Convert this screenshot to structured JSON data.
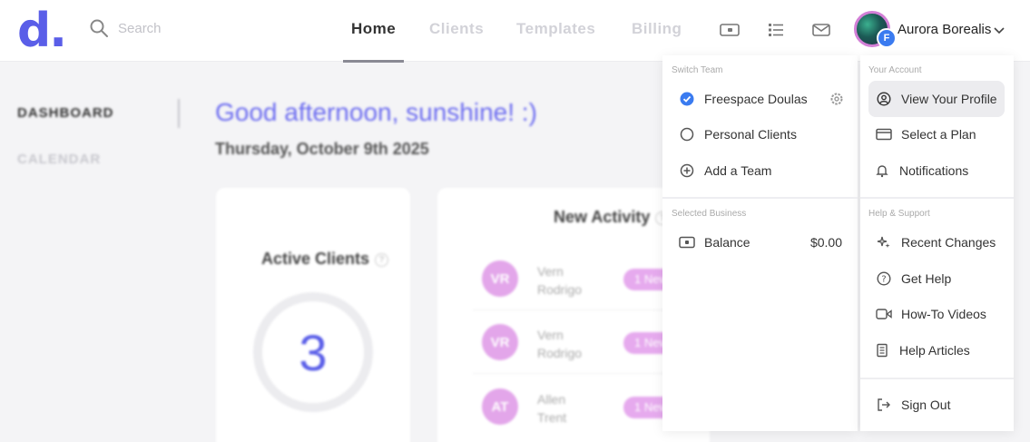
{
  "brand": {
    "logo_text": "d."
  },
  "search": {
    "placeholder": "Search"
  },
  "nav": {
    "home": "Home",
    "clients": "Clients",
    "templates": "Templates",
    "billing": "Billing"
  },
  "user": {
    "name": "Aurora Borealis",
    "badge_letter": "F"
  },
  "sidebar": {
    "dashboard": "DASHBOARD",
    "calendar": "CALENDAR"
  },
  "main": {
    "greeting": "Good afternoon, sunshine! :)",
    "date": "Thursday, October 9th 2025",
    "active_clients": {
      "title": "Active Clients",
      "count": "3"
    },
    "new_activity": {
      "title": "New Activity",
      "rows": [
        {
          "initials": "VR",
          "first": "Vern",
          "last": "Rodrigo",
          "pill": "1 New"
        },
        {
          "initials": "VR",
          "first": "Vern",
          "last": "Rodrigo",
          "pill": "1 New"
        },
        {
          "initials": "AT",
          "first": "Allen",
          "last": "Trent",
          "pill": "1 New"
        }
      ]
    }
  },
  "dropdown": {
    "switch_team": {
      "heading": "Switch Team",
      "items": [
        "Freespace Doulas",
        "Personal Clients",
        "Add a Team"
      ]
    },
    "selected_business": {
      "heading": "Selected Business",
      "balance_label": "Balance",
      "balance_value": "$0.00"
    },
    "account": {
      "heading": "Your Account",
      "items": [
        "View Your Profile",
        "Select a Plan",
        "Notifications"
      ]
    },
    "help": {
      "heading": "Help & Support",
      "items": [
        "Recent Changes",
        "Get Help",
        "How-To Videos",
        "Help Articles"
      ]
    },
    "sign_out": "Sign Out"
  },
  "colors": {
    "brand": "#5a5ee8",
    "accent_pink": "#e3a6ea",
    "check_blue": "#3a7bf0"
  }
}
